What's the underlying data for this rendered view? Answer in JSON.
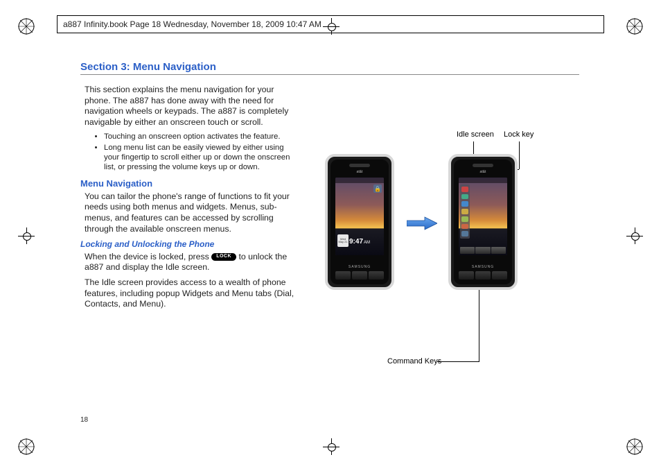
{
  "crop_header": "a887 Infinity.book  Page 18  Wednesday, November 18, 2009  10:47 AM",
  "section_title": "Section 3: Menu Navigation",
  "intro": "This section explains the menu navigation for your phone. The a887 has done away with the need for navigation wheels or keypads. The a887 is completely navigable by either an onscreen touch or scroll.",
  "bullets": [
    "Touching an onscreen option activates the feature.",
    "Long menu list can be easily viewed by either using your fingertip to scroll either up or down the onscreen list, or pressing the volume keys up or down."
  ],
  "h2_menu_nav": "Menu Navigation",
  "menu_nav_body": "You can tailor the phone's range of functions to fit your needs using both menus and widgets. Menus, sub-menus, and features can be accessed by scrolling through the available onscreen menus.",
  "h3_lock": "Locking and Unlocking the Phone",
  "lock_body_prefix": "When the device is locked, press ",
  "lock_chip": "LOCK",
  "lock_body_suffix": " to unlock the a887 and display the Idle screen.",
  "idle_body": "The Idle screen provides access to a wealth of phone features, including popup Widgets and Menu tabs (Dial, Contacts, and Menu).",
  "page_number": "18",
  "labels": {
    "idle_screen": "Idle screen",
    "lock_key": "Lock key",
    "command_keys": "Command Keys"
  },
  "phone": {
    "carrier": "at&t",
    "brand": "SAMSUNG",
    "clock_time": "9:47",
    "clock_ampm": "AM",
    "date_dow": "Wed",
    "date_md": "May 21",
    "lock_glyph": "🔒"
  }
}
